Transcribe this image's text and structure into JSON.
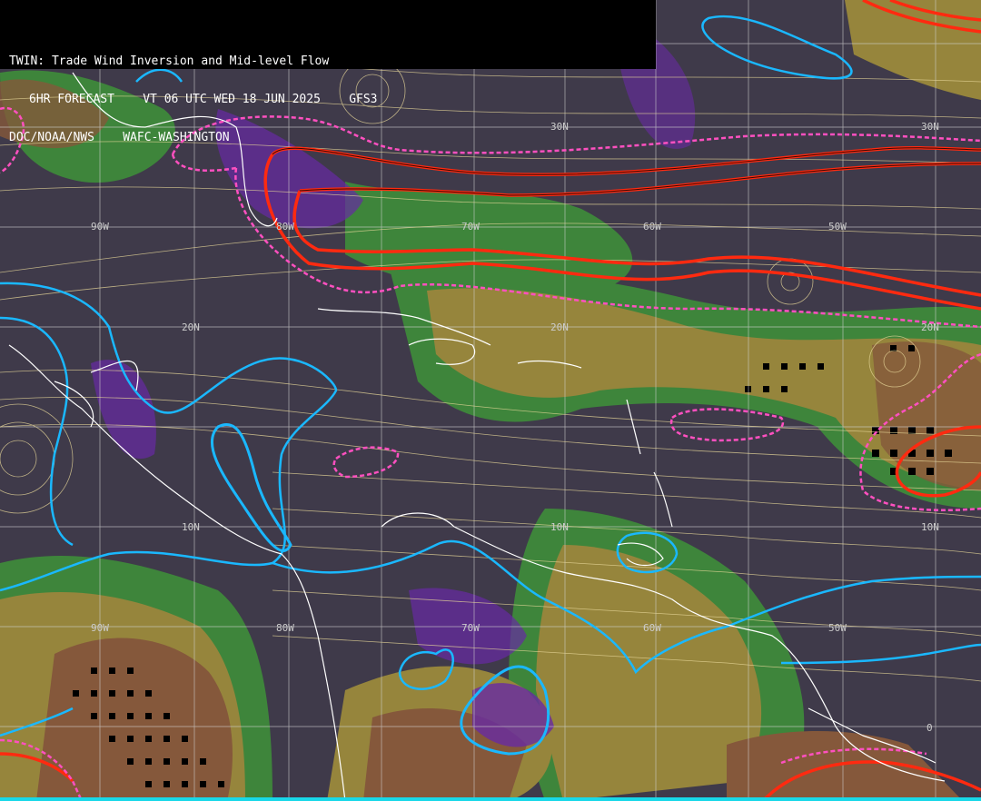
{
  "header": {
    "line1": "TWIN: Trade Wind Inversion and Mid-level Flow",
    "line2": "6HR FORECAST    VT 06 UTC WED 18 JUN 2025    GFS3",
    "line3": "DOC/NOAA/NWS    WAFC-WASHINGTON"
  },
  "labels": {
    "lat30_a": "30N",
    "lat30_b": "30N",
    "lat20_a": "20N",
    "lat20_b": "20N",
    "lat20_c": "20N",
    "lat10_a": "10N",
    "lat10_b": "10N",
    "lat10_c": "10N",
    "lat0": "0",
    "lon90_a": "90W",
    "lon80_a": "80W",
    "lon70_a": "70W",
    "lon60_a": "60W",
    "lon50_a": "50W",
    "lon90_b": "90W",
    "lon80_b": "80W",
    "lon70_b": "70W",
    "lon60_b": "60W",
    "lon50_b": "50W"
  },
  "colors": {
    "background": "#3f3a4a",
    "green": "#3f8a3a",
    "olive": "#9b8a3c",
    "brown": "#8a5a3a",
    "purple": "#6a2aa8",
    "blue": "#3f4a9a",
    "cyan_contour": "#1ab8ff",
    "red_contour": "#ff2a10",
    "pink_dashed": "#ff50c0",
    "streamline": "#e8d89a",
    "coast": "#ffffff",
    "grid": "#cfcfcf"
  }
}
